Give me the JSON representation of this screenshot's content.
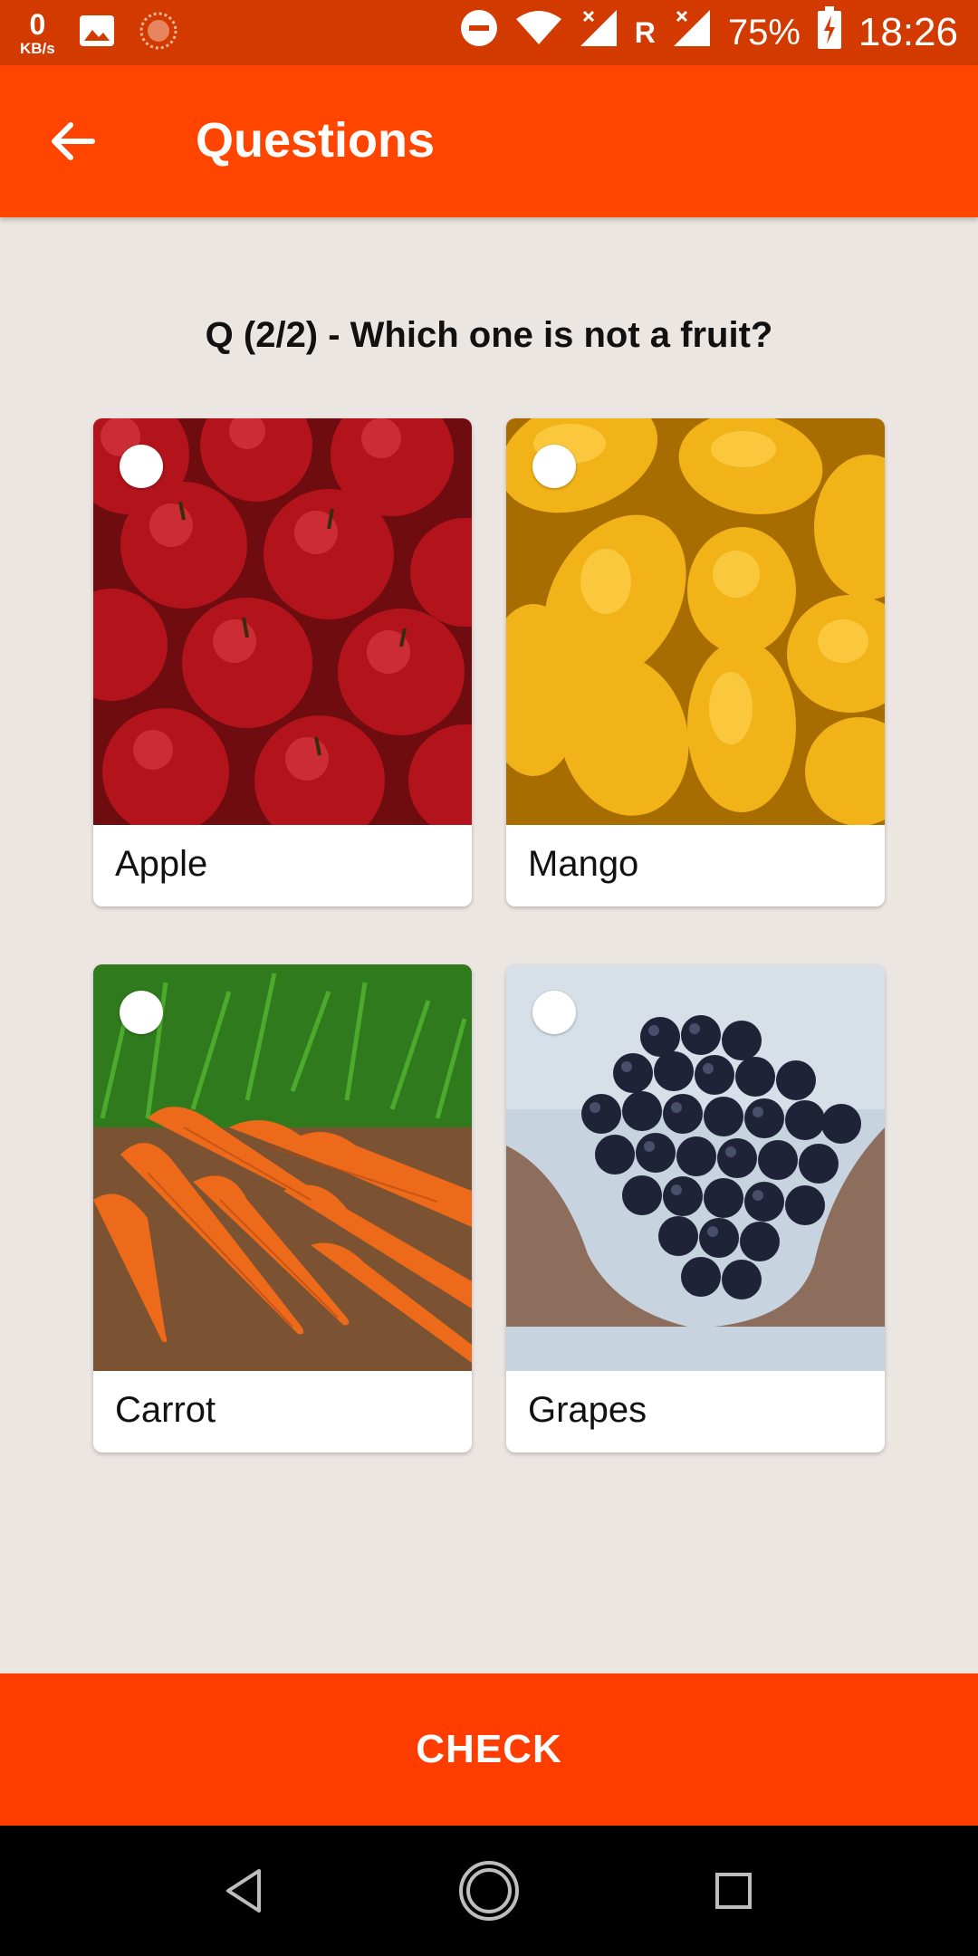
{
  "status_bar": {
    "speed_value": "0",
    "speed_unit": "KB/s",
    "roaming_label": "R",
    "battery_percent": "75%",
    "time": "18:26",
    "icons": [
      "image-icon",
      "circle-loader-icon",
      "do-not-disturb-icon",
      "wifi-icon",
      "signal-icon",
      "signal-icon",
      "battery-charging-icon"
    ]
  },
  "app_bar": {
    "title": "Questions",
    "back_icon": "arrow-left-icon"
  },
  "question": {
    "text": "Q (2/2) - Which one is not a fruit?"
  },
  "options": [
    {
      "label": "Apple",
      "selected": false,
      "image": "apples-photo"
    },
    {
      "label": "Mango",
      "selected": false,
      "image": "mangoes-photo"
    },
    {
      "label": "Carrot",
      "selected": false,
      "image": "carrots-photo"
    },
    {
      "label": "Grapes",
      "selected": false,
      "image": "grapes-photo"
    }
  ],
  "actions": {
    "check_label": "CHECK"
  },
  "nav_bar": {
    "icons": [
      "back-triangle-icon",
      "home-circle-icon",
      "recents-square-icon"
    ]
  },
  "colors": {
    "status_bar": "#d23a00",
    "accent": "#ff4500",
    "button": "#ff3d00",
    "background": "#ece6e3"
  }
}
